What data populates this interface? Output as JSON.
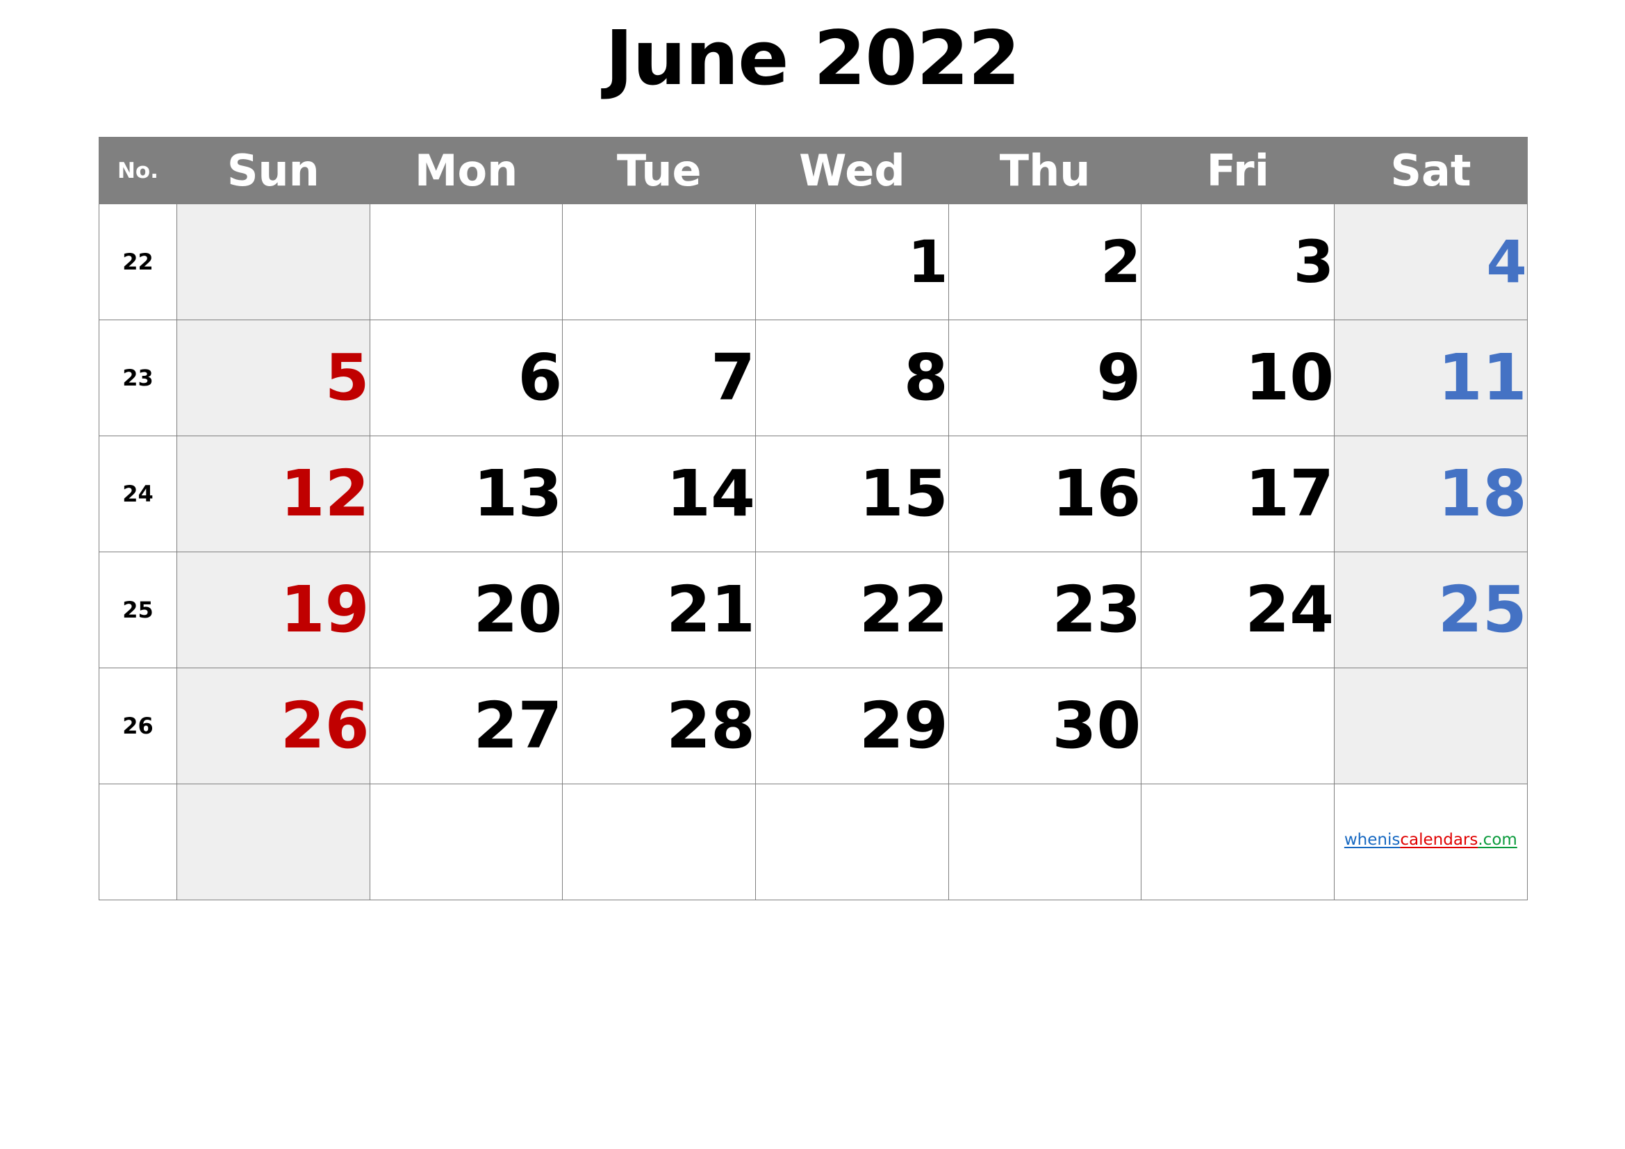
{
  "title": "June 2022",
  "colors": {
    "header_bg": "#808080",
    "header_text": "#ffffff",
    "weekend_bg": "#efefef",
    "sunday_text": "#c00000",
    "saturday_text": "#4472c4",
    "weekday_text": "#000000",
    "grid_border": "#7f7f7f"
  },
  "header": {
    "week_no_label": "No.",
    "days": [
      "Sun",
      "Mon",
      "Tue",
      "Wed",
      "Thu",
      "Fri",
      "Sat"
    ]
  },
  "weeks": [
    {
      "no": "22",
      "days": [
        "",
        "",
        "",
        "1",
        "2",
        "3",
        "4"
      ]
    },
    {
      "no": "23",
      "days": [
        "5",
        "6",
        "7",
        "8",
        "9",
        "10",
        "11"
      ]
    },
    {
      "no": "24",
      "days": [
        "12",
        "13",
        "14",
        "15",
        "16",
        "17",
        "18"
      ]
    },
    {
      "no": "25",
      "days": [
        "19",
        "20",
        "21",
        "22",
        "23",
        "24",
        "25"
      ]
    },
    {
      "no": "26",
      "days": [
        "26",
        "27",
        "28",
        "29",
        "30",
        "",
        ""
      ]
    },
    {
      "no": "",
      "days": [
        "",
        "",
        "",
        "",
        "",
        "",
        ""
      ]
    }
  ],
  "watermark": {
    "part1": "whenis",
    "part2": "calendars",
    "part3": ".com"
  }
}
